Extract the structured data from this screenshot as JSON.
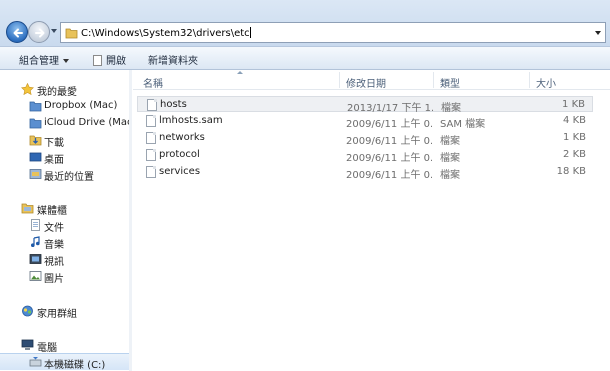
{
  "address": {
    "path": "C:\\Windows\\System32\\drivers\\etc"
  },
  "toolbar": {
    "organize": "組合管理",
    "open": "開啟",
    "new_folder": "新增資料夾"
  },
  "sidebar": {
    "favorites_label": "我的最愛",
    "favorites": [
      {
        "label": "Dropbox (Mac)",
        "icon": "dropbox-folder-icon"
      },
      {
        "label": "iCloud Drive (Mac)",
        "icon": "icloud-folder-icon"
      },
      {
        "label": "下載",
        "icon": "downloads-icon"
      },
      {
        "label": "桌面",
        "icon": "desktop-icon"
      },
      {
        "label": "最近的位置",
        "icon": "recent-places-icon"
      }
    ],
    "libraries_label": "媒體櫃",
    "libraries": [
      {
        "label": "文件",
        "icon": "documents-icon"
      },
      {
        "label": "音樂",
        "icon": "music-icon"
      },
      {
        "label": "視訊",
        "icon": "videos-icon"
      },
      {
        "label": "圖片",
        "icon": "pictures-icon"
      }
    ],
    "homegroup_label": "家用群組",
    "computer_label": "電腦",
    "drive_label": "本機磁碟 (C:)"
  },
  "columns": {
    "name": "名稱",
    "date": "修改日期",
    "type": "類型",
    "size": "大小"
  },
  "files": [
    {
      "name": "hosts",
      "date": "2013/1/17 下午 1...",
      "type": "檔案",
      "size": "1 KB"
    },
    {
      "name": "lmhosts.sam",
      "date": "2009/6/11 上午 0...",
      "type": "SAM 檔案",
      "size": "4 KB"
    },
    {
      "name": "networks",
      "date": "2009/6/11 上午 0...",
      "type": "檔案",
      "size": "1 KB"
    },
    {
      "name": "protocol",
      "date": "2009/6/11 上午 0...",
      "type": "檔案",
      "size": "2 KB"
    },
    {
      "name": "services",
      "date": "2009/6/11 上午 0...",
      "type": "檔案",
      "size": "18 KB"
    }
  ],
  "colors": {
    "accent": "#2d6fc0",
    "selection": "#d5e5f7"
  }
}
